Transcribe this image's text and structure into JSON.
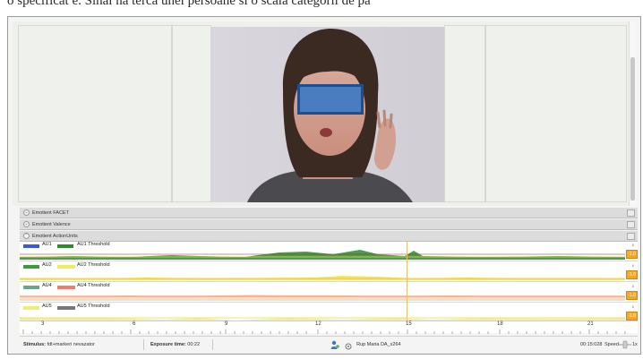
{
  "caption_fragment": "o specificat e. Sinal na tercă unei persoane si o scala categorii de pa",
  "sections": [
    {
      "label": "Emotient FACET",
      "expanded": false
    },
    {
      "label": "Emotient Valence",
      "expanded": false
    },
    {
      "label": "Emotient ActionUnits",
      "expanded": true
    }
  ],
  "tracks": [
    {
      "au": "AU1",
      "threshold": "AU1 Threshold",
      "color": "#3a5bd6",
      "thr_color": "#2e8b2e",
      "value": "-1.0",
      "top_value": "6",
      "line_color": "#2e8b2e"
    },
    {
      "au": "AU2",
      "threshold": "AU2 Threshold",
      "color": "#3d9a3d",
      "thr_color": "#f3ea63",
      "value": "-1.0",
      "top_value": "6",
      "line_color": "#e5c21a"
    },
    {
      "au": "AU4",
      "threshold": "AU4 Threshold",
      "color": "#6aa788",
      "thr_color": "#f07b6e",
      "value": "-1.0",
      "top_value": "6",
      "line_color": "#f08a5d"
    },
    {
      "au": "AU5",
      "threshold": "AU5 Threshold",
      "color": "#eded72",
      "thr_color": "#777777",
      "value": "-1.0",
      "top_value": "6",
      "line_color": "#e9d84a"
    }
  ],
  "ruler": {
    "ticks": [
      "3",
      "6",
      "9",
      "12",
      "15",
      "18",
      "21"
    ]
  },
  "status": {
    "stimulus_label": "Stimulus:",
    "stimulus_value": "fdt+markeri nevazator",
    "exposure_label": "Exposure time:",
    "exposure_value": "00:22",
    "respondent": "Rup Maria DA_x264",
    "time": "00:15:028",
    "speed_label": "Speed",
    "speed_suffix": "1x"
  },
  "colors": {
    "accent_orange": "#f5a623",
    "section_bar": "#dcdcdc"
  }
}
